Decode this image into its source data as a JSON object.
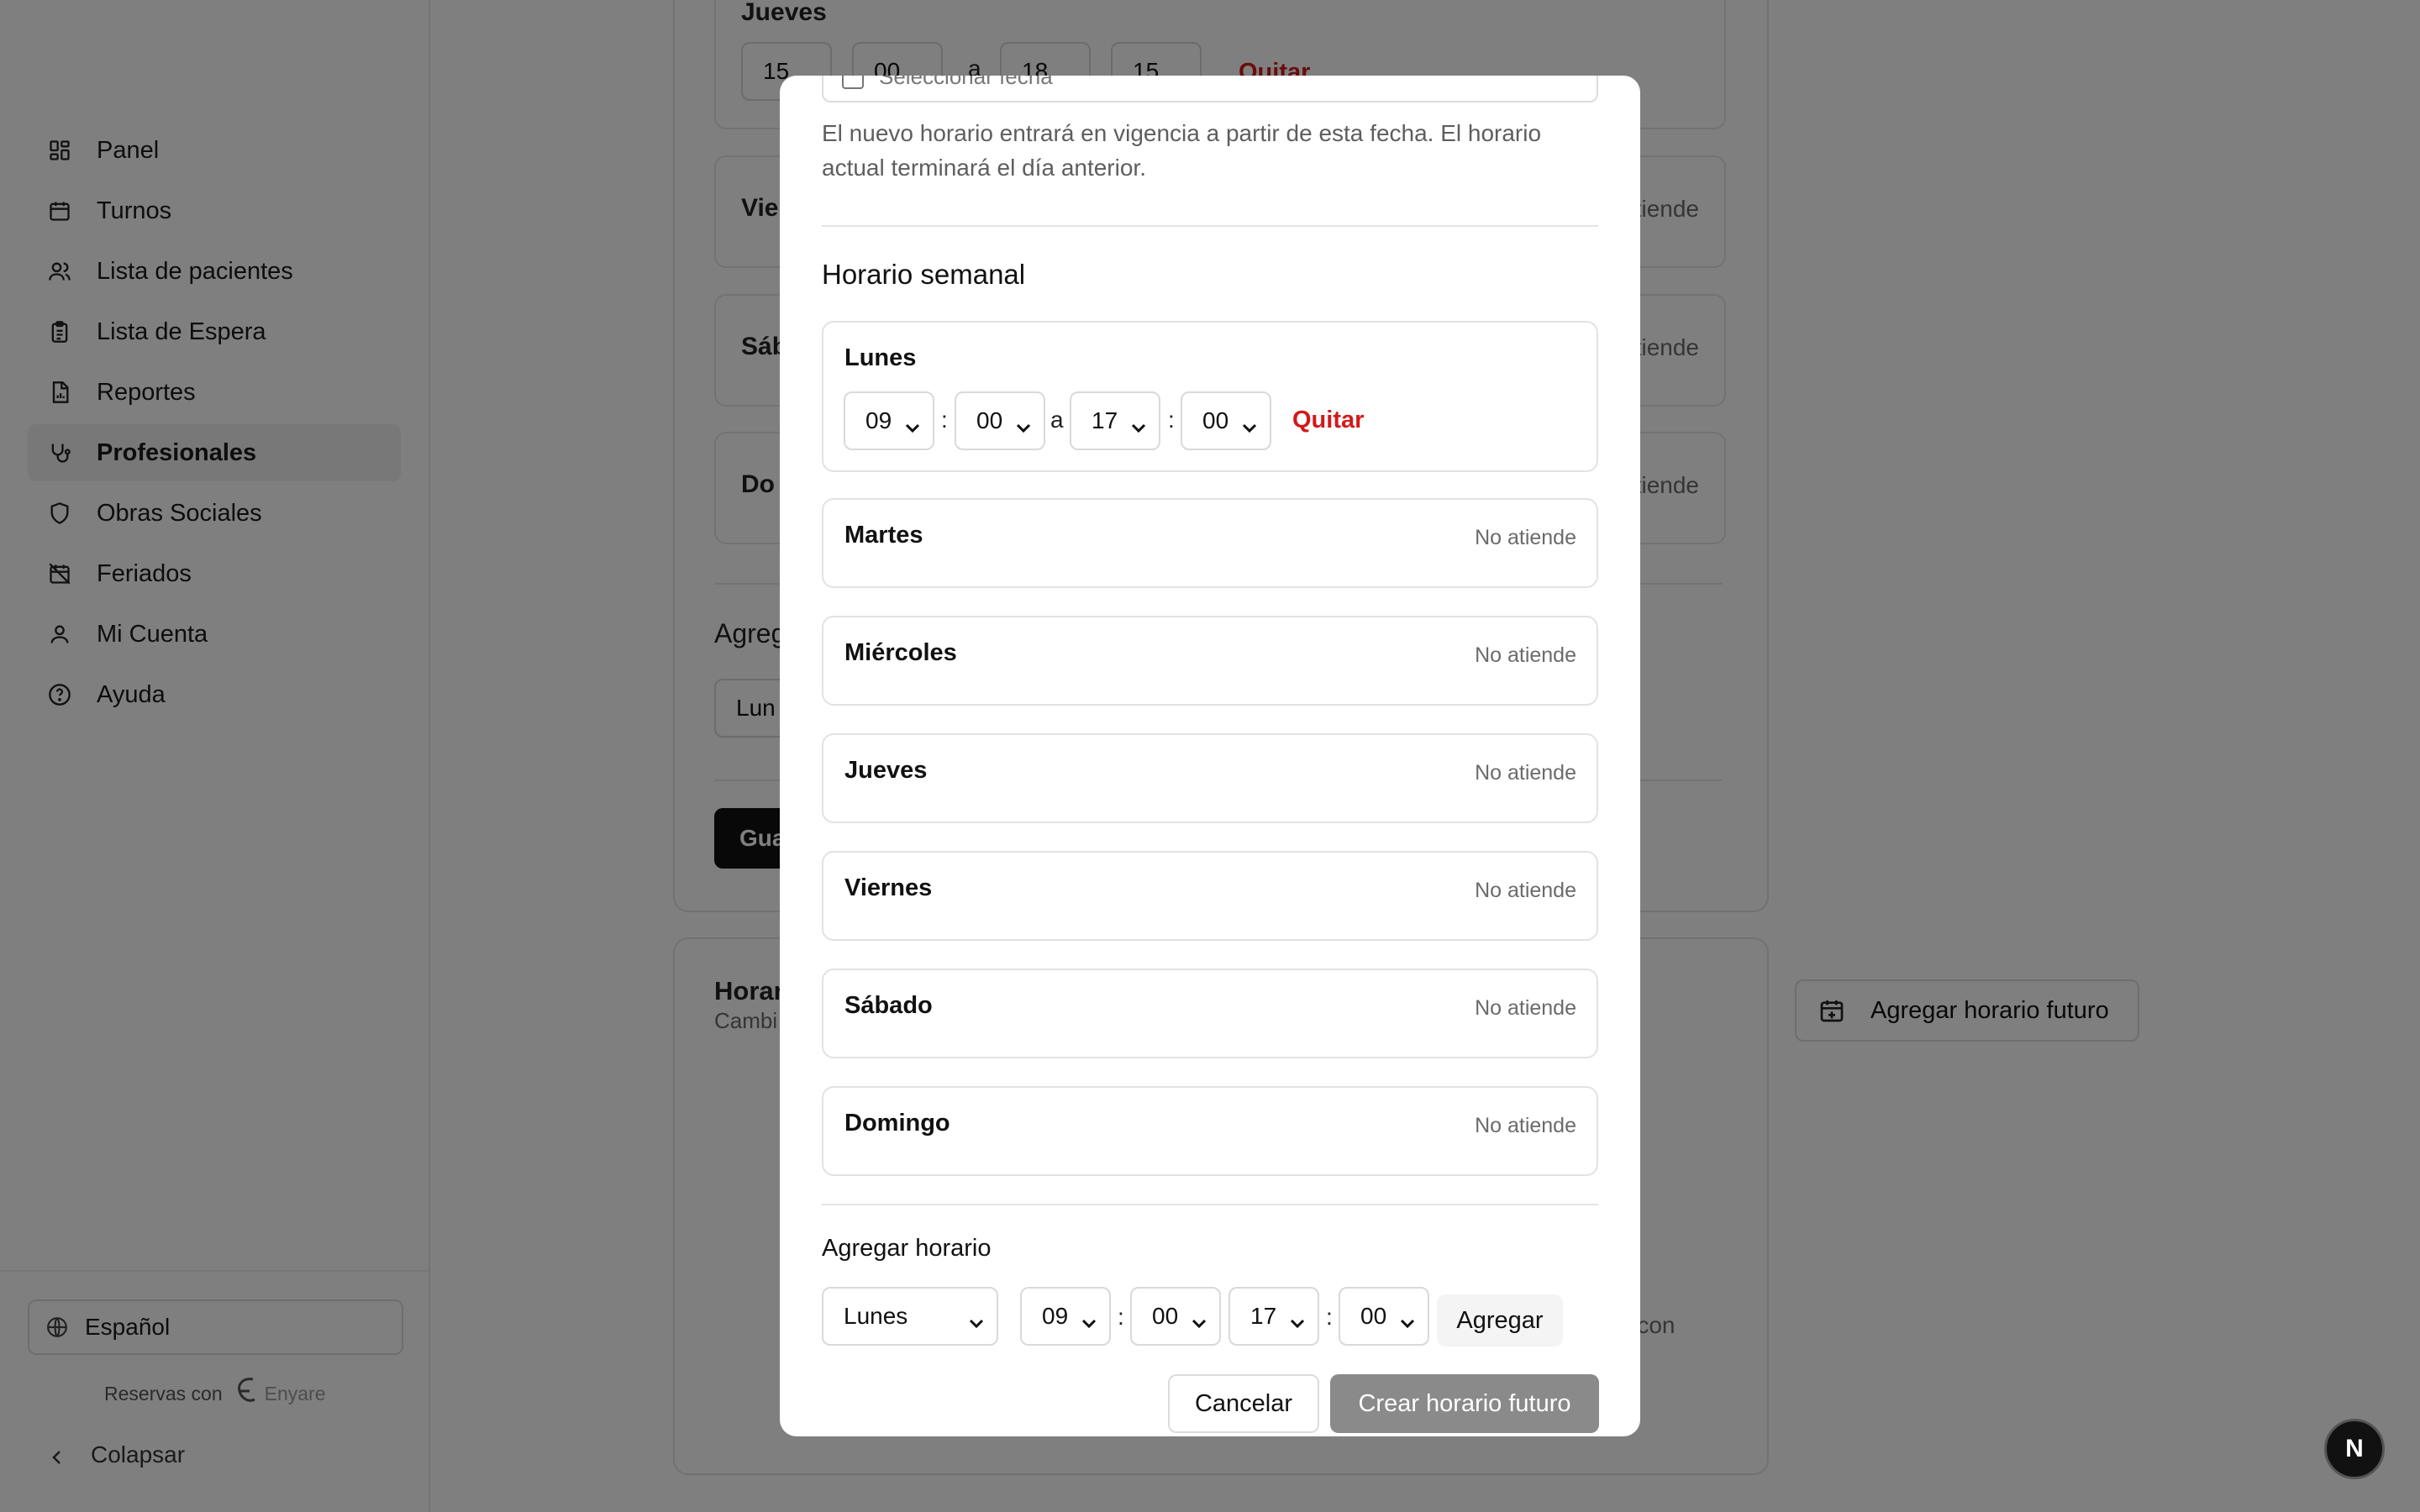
{
  "sidebar": {
    "items": [
      {
        "label": "Panel",
        "icon": "dashboard-icon"
      },
      {
        "label": "Turnos",
        "icon": "calendar-icon"
      },
      {
        "label": "Lista de pacientes",
        "icon": "users-icon"
      },
      {
        "label": "Lista de Espera",
        "icon": "clipboard-list-icon"
      },
      {
        "label": "Reportes",
        "icon": "report-file-icon"
      },
      {
        "label": "Profesionales",
        "icon": "stethoscope-icon"
      },
      {
        "label": "Obras Sociales",
        "icon": "shield-icon"
      },
      {
        "label": "Feriados",
        "icon": "calendar-off-icon"
      },
      {
        "label": "Mi Cuenta",
        "icon": "user-icon"
      },
      {
        "label": "Ayuda",
        "icon": "help-circle-icon"
      }
    ],
    "active_item": "Profesionales",
    "language": "Español",
    "powered_by": "Reservas con",
    "brand": "Enyare",
    "collapse_label": "Colapsar"
  },
  "background": {
    "jueves_label": "Jueves",
    "jueves_from_h": "15",
    "jueves_from_m": "00",
    "jueves_sep": "a",
    "jueves_to_h": "18",
    "jueves_to_m": "15",
    "jueves_remove": "Quitar",
    "rows": [
      {
        "label": "Vie",
        "status": "No atiende"
      },
      {
        "label": "Sáb",
        "status": "No atiende"
      },
      {
        "label": "Do",
        "status": "No atiende"
      }
    ],
    "add_title": "Agreg",
    "add_select": "Lun",
    "save_button": "Gua",
    "future_title": "Horar",
    "future_subtitle": "Cambi",
    "future_button": "Agregar horario futuro",
    "empty_text_fragment": "os con"
  },
  "modal": {
    "date_checkbox_label": "Seleccionar fecha",
    "help_text": "El nuevo horario entrará en vigencia a partir de esta fecha. El horario actual terminará el día anterior.",
    "weekly_title": "Horario semanal",
    "monday": {
      "label": "Lunes",
      "from_hour": "09",
      "from_min": "00",
      "separator": "a",
      "to_hour": "17",
      "to_min": "00",
      "remove_label": "Quitar"
    },
    "days": [
      {
        "label": "Martes",
        "status": "No atiende"
      },
      {
        "label": "Miércoles",
        "status": "No atiende"
      },
      {
        "label": "Jueves",
        "status": "No atiende"
      },
      {
        "label": "Viernes",
        "status": "No atiende"
      },
      {
        "label": "Sábado",
        "status": "No atiende"
      },
      {
        "label": "Domingo",
        "status": "No atiende"
      }
    ],
    "add_section_title": "Agregar horario",
    "add": {
      "day": "Lunes",
      "from_hour": "09",
      "from_min": "00",
      "to_hour": "17",
      "to_min": "00",
      "button": "Agregar"
    },
    "cancel_button": "Cancelar",
    "submit_button": "Crear horario futuro"
  },
  "dev_badge": "N",
  "colors": {
    "accent_red": "#d11a1a",
    "dark": "#111111",
    "overlay": "rgba(0,0,0,0.5)"
  }
}
